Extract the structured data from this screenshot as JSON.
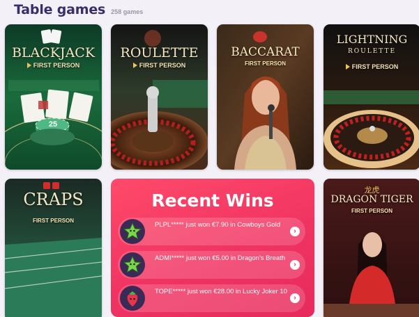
{
  "header": {
    "title": "Table games",
    "count": "258 games"
  },
  "cards": {
    "blackjack": {
      "logo": "BLACKJACK",
      "sub": "FIRST PERSON",
      "chip_value": "25"
    },
    "roulette": {
      "logo": "ROULETTE",
      "sub": "FIRST PERSON"
    },
    "baccarat": {
      "logo": "BACCARAT",
      "sub": "FIRST PERSON"
    },
    "lightning": {
      "logo": "LIGHTNING",
      "logo2": "ROULETTE",
      "sub": "FIRST PERSON"
    },
    "craps": {
      "logo": "CRAPS",
      "sub": "FIRST PERSON"
    },
    "dragon_tiger": {
      "logo": "DRAGON TIGER",
      "sub": "FIRST PERSON",
      "chinese": "龙虎"
    }
  },
  "recent_wins": {
    "title": "Recent Wins",
    "items": [
      {
        "text": "PLPL***** just won €7.90 in Cowboys Gold",
        "icon": "green-star-icon",
        "arrow": "›"
      },
      {
        "text": "ADMI***** just won €5.00 in Dragon's Breath",
        "icon": "green-star-icon",
        "arrow": "›"
      },
      {
        "text": "TOPE***** just won €28.00 in Lucky Joker 10",
        "icon": "strawberry-icon",
        "arrow": "›"
      }
    ]
  },
  "colors": {
    "brand_title": "#3a2d6b",
    "wins_bg": "#f03462",
    "page_bg": "#f3f1f7"
  }
}
